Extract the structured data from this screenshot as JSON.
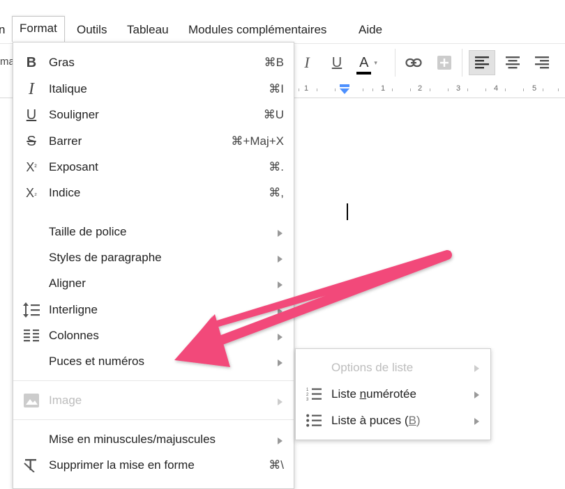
{
  "menubar": {
    "items": [
      {
        "label": "n"
      },
      {
        "label": "Format"
      },
      {
        "label": "Outils"
      },
      {
        "label": "Tableau"
      },
      {
        "label": "Modules complémentaires"
      },
      {
        "label": "Aide"
      }
    ]
  },
  "toolbar": {
    "left_cut": "ma",
    "italic": "I",
    "underline": "U",
    "text_color": "A"
  },
  "ruler": {
    "labels": [
      "1",
      "1",
      "2",
      "3",
      "4",
      "5"
    ]
  },
  "format_menu": {
    "items": [
      {
        "icon": "bold-icon",
        "label": "Gras",
        "shortcut": "⌘B"
      },
      {
        "icon": "italic-icon",
        "label": "Italique",
        "shortcut": "⌘I"
      },
      {
        "icon": "underline-icon",
        "label": "Souligner",
        "shortcut": "⌘U"
      },
      {
        "icon": "strikethrough-icon",
        "label": "Barrer",
        "shortcut": "⌘+Maj+X"
      },
      {
        "icon": "superscript-icon",
        "label": "Exposant",
        "shortcut": "⌘."
      },
      {
        "icon": "subscript-icon",
        "label": "Indice",
        "shortcut": "⌘,"
      },
      {
        "label": "Taille de police"
      },
      {
        "label": "Styles de paragraphe"
      },
      {
        "label": "Aligner"
      },
      {
        "icon": "line-spacing-icon",
        "label": "Interligne"
      },
      {
        "icon": "columns-icon",
        "label": "Colonnes"
      },
      {
        "label": "Puces et numéros"
      },
      {
        "icon": "image-icon",
        "label": "Image"
      },
      {
        "label": "Mise en minuscules/majuscules"
      },
      {
        "icon": "clear-formatting-icon",
        "label": "Supprimer la mise en forme",
        "shortcut": "⌘\\"
      }
    ]
  },
  "list_submenu": {
    "options_label": "Options de liste",
    "numbered_pre": "Liste ",
    "numbered_ul": "n",
    "numbered_post": "umérotée",
    "bulleted_pre": "Liste à puces (",
    "bulleted_ul": "B",
    "bulleted_post": ")"
  },
  "colors": {
    "arrow": "#f2497a",
    "menu_border": "#cfcfcf",
    "disabled_text": "#bdbdbd",
    "ruler_indent": "#4d90fe"
  }
}
